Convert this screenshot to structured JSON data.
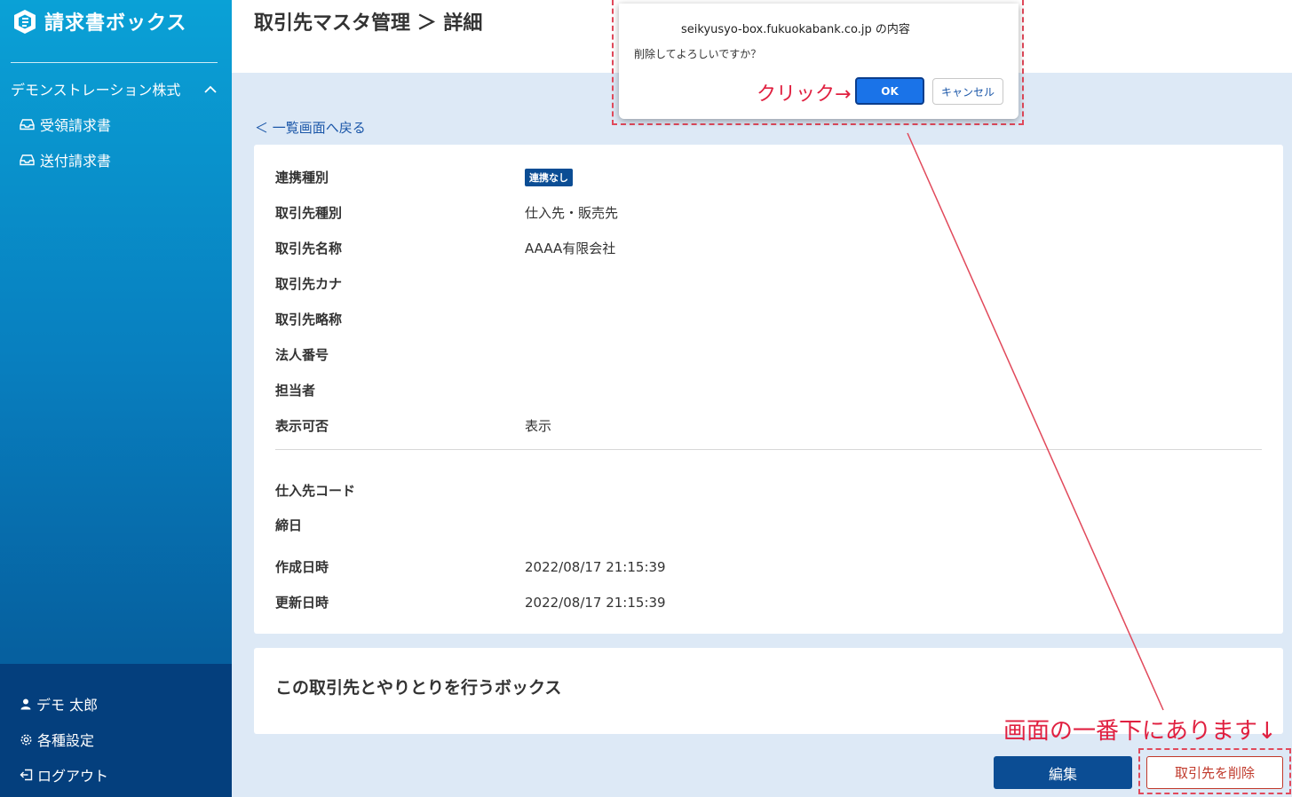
{
  "app": {
    "name": "請求書ボックス"
  },
  "sidebar": {
    "company": "デモンストレーション株式",
    "items": [
      {
        "label": "受領請求書",
        "icon": "inbox-icon"
      },
      {
        "label": "送付請求書",
        "icon": "inbox-icon"
      }
    ],
    "bottom": [
      {
        "label": "デモ 太郎",
        "icon": "user-icon"
      },
      {
        "label": "各種設定",
        "icon": "gear-icon"
      },
      {
        "label": "ログアウト",
        "icon": "logout-icon"
      }
    ]
  },
  "header": {
    "title": "取引先マスタ管理 ＞ 詳細"
  },
  "back_link": "＜ 一覧画面へ戻る",
  "detail": {
    "rows": [
      {
        "label": "連携種別",
        "value": "連携なし"
      },
      {
        "label": "取引先種別",
        "value": "仕入先・販売先"
      },
      {
        "label": "取引先名称",
        "value": "AAAA有限会社"
      },
      {
        "label": "取引先カナ",
        "value": ""
      },
      {
        "label": "取引先略称",
        "value": ""
      },
      {
        "label": "法人番号",
        "value": ""
      },
      {
        "label": "担当者",
        "value": ""
      },
      {
        "label": "表示可否",
        "value": "表示"
      },
      {
        "label": "仕入先コード",
        "value": ""
      },
      {
        "label": "締日",
        "value": ""
      },
      {
        "label": "作成日時",
        "value": "2022/08/17 21:15:39"
      },
      {
        "label": "更新日時",
        "value": "2022/08/17 21:15:39"
      }
    ]
  },
  "box_section": {
    "title": "この取引先とやりとりを行うボックス"
  },
  "buttons": {
    "edit": "編集",
    "delete": "取引先を削除"
  },
  "dialog": {
    "origin": "seikyusyo-box.fukuokabank.co.jp の内容",
    "message": "削除してよろしいですか？",
    "ok": "OK",
    "cancel": "キャンセル"
  },
  "annotations": {
    "click": "クリック→",
    "bottom_note": "画面の一番下にあります↓"
  },
  "colors": {
    "brand": "#0b4d94",
    "annotation": "#e02040",
    "delete": "#c0392b"
  }
}
